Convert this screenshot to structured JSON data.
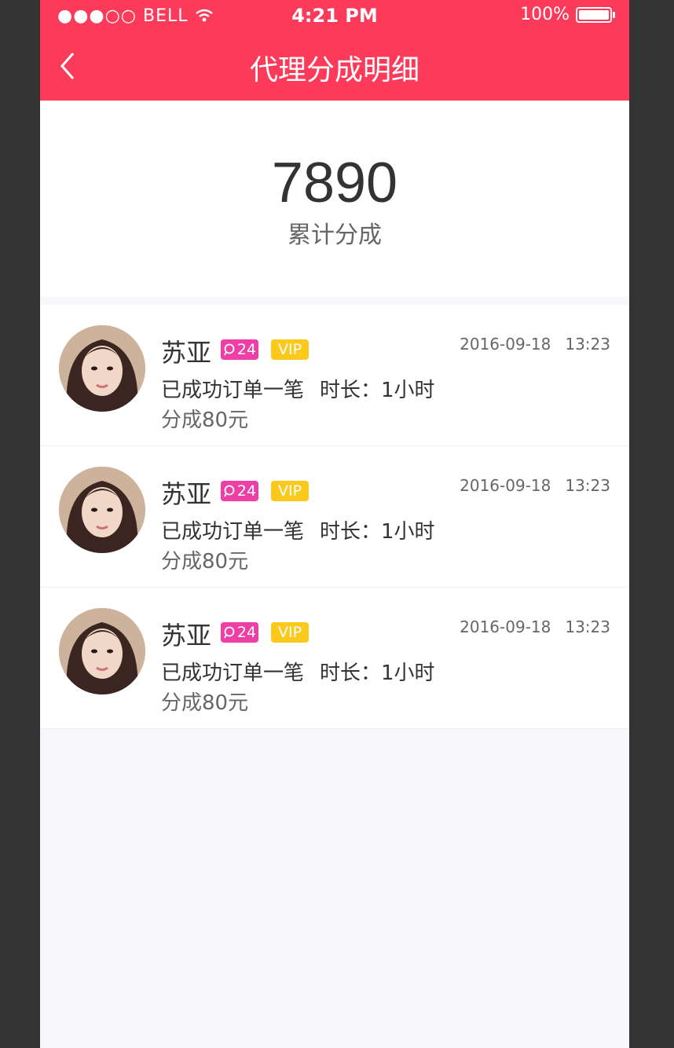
{
  "status_bar": {
    "signal": "●●●○○",
    "carrier": "BELL",
    "time": "4:21 PM",
    "battery": "100%",
    "battery_level": 1.0
  },
  "header": {
    "title": "代理分成明细",
    "background": "#fc3a5a"
  },
  "summary": {
    "amount": "7890",
    "label": "累计分成"
  },
  "records": [
    {
      "name": "苏亚",
      "count": "24",
      "badge": "VIP",
      "date": "2016-09-18",
      "time": "13:23",
      "order_text": "已成功订单一笔",
      "duration": "时长：1小时",
      "share": "分成80元"
    },
    {
      "name": "苏亚",
      "count": "24",
      "badge": "VIP",
      "date": "2016-09-18",
      "time": "13:23",
      "order_text": "已成功订单一笔",
      "duration": "时长：1小时",
      "share": "分成80元"
    },
    {
      "name": "苏亚",
      "count": "24",
      "badge": "VIP",
      "date": "2016-09-18",
      "time": "13:23",
      "order_text": "已成功订单一笔",
      "duration": "时长：1小时",
      "share": "分成80元"
    }
  ],
  "colors": {
    "accent": "#fc3a5a",
    "primary_text": "#333333",
    "secondary_text": "#666666",
    "page_bg": "#f8f8fc",
    "divider": "#eeeeee",
    "badge_pink": "#ed3fa6",
    "badge_yellow": "#fbc91b"
  }
}
